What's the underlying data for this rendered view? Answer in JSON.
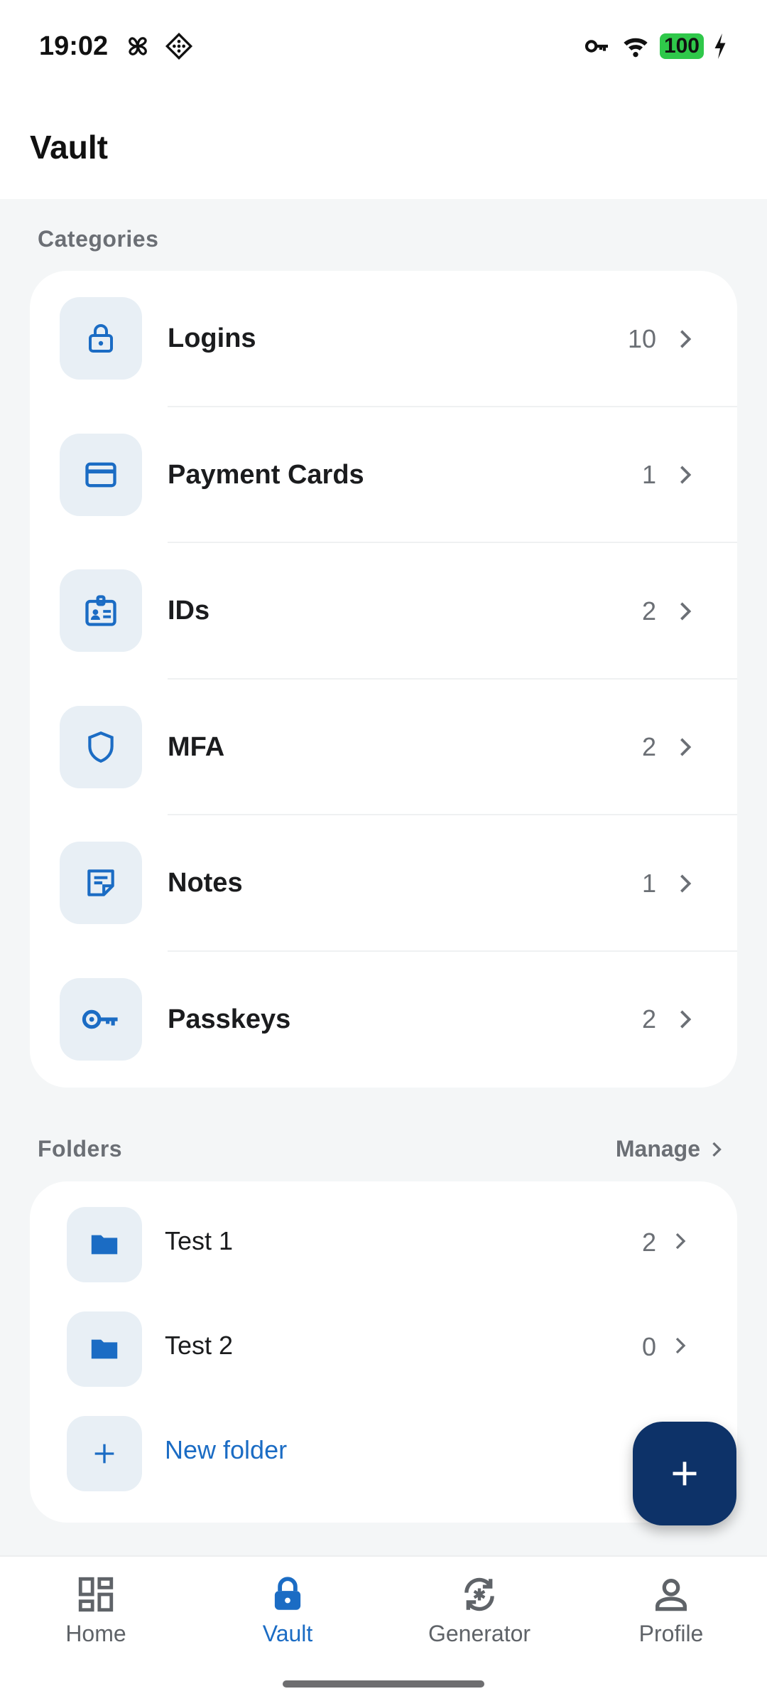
{
  "status_bar": {
    "time": "19:02",
    "battery": "100"
  },
  "header": {
    "title": "Vault"
  },
  "categories": {
    "label": "Categories",
    "items": [
      {
        "label": "Logins",
        "count": "10",
        "icon": "lock-icon"
      },
      {
        "label": "Payment Cards",
        "count": "1",
        "icon": "card-icon"
      },
      {
        "label": "IDs",
        "count": "2",
        "icon": "id-badge-icon"
      },
      {
        "label": "MFA",
        "count": "2",
        "icon": "shield-icon"
      },
      {
        "label": "Notes",
        "count": "1",
        "icon": "note-icon"
      },
      {
        "label": "Passkeys",
        "count": "2",
        "icon": "key-icon"
      }
    ]
  },
  "folders": {
    "label": "Folders",
    "manage_label": "Manage",
    "items": [
      {
        "label": "Test 1",
        "count": "2",
        "icon": "folder-icon"
      },
      {
        "label": "Test 2",
        "count": "0",
        "icon": "folder-icon"
      }
    ],
    "new_folder_label": "New folder"
  },
  "bottom_nav": {
    "items": [
      {
        "label": "Home",
        "icon": "grid-icon",
        "active": false
      },
      {
        "label": "Vault",
        "icon": "lock-icon",
        "active": true
      },
      {
        "label": "Generator",
        "icon": "refresh-asterisk-icon",
        "active": false
      },
      {
        "label": "Profile",
        "icon": "person-icon",
        "active": false
      }
    ]
  },
  "colors": {
    "accent": "#1b6cc4",
    "fab": "#0d3268",
    "tile": "#e8eff5",
    "background": "#f4f6f7"
  }
}
